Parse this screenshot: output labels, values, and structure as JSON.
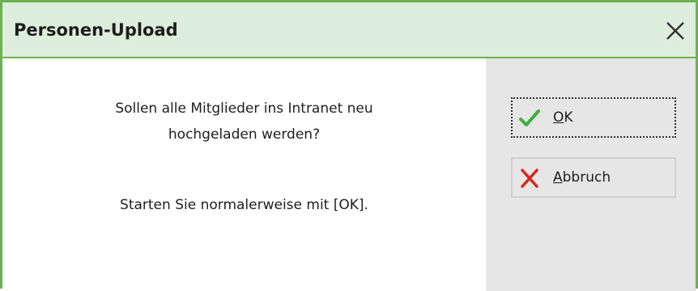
{
  "dialog": {
    "title": "Personen-Upload",
    "close_icon": "close-icon"
  },
  "message": {
    "line1": "Sollen alle Mitglieder ins Intranet neu",
    "line2": "hochgeladen werden?",
    "line3": "Starten Sie normalerweise mit [OK]."
  },
  "buttons": {
    "ok": {
      "mnemonic": "O",
      "rest": "K",
      "icon": "checkmark-icon"
    },
    "cancel": {
      "mnemonic": "A",
      "rest": "bbruch",
      "icon": "cross-icon"
    }
  },
  "colors": {
    "accent_border": "#6fb150",
    "title_bg": "#ddeedd",
    "panel_bg": "#e6e6e6",
    "ok_green": "#3fae3f",
    "cancel_red": "#d9261c"
  }
}
